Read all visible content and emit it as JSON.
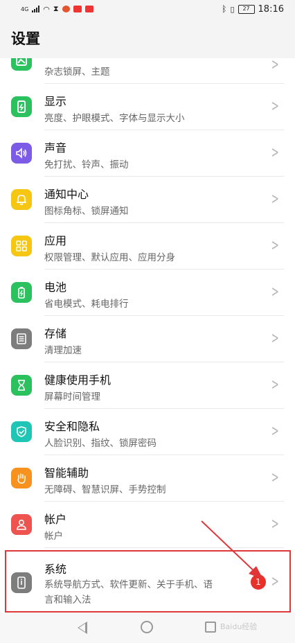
{
  "status_bar": {
    "network": "4G",
    "time": "18:16",
    "battery": "27"
  },
  "header": {
    "title": "设置"
  },
  "items": [
    {
      "title": "",
      "subtitle": "杂志锁屏、主题",
      "icon": "wallpaper-icon",
      "color": "#2cc15f"
    },
    {
      "title": "显示",
      "subtitle": "亮度、护眼模式、字体与显示大小",
      "icon": "display-icon",
      "color": "#2cc15f"
    },
    {
      "title": "声音",
      "subtitle": "免打扰、铃声、振动",
      "icon": "speaker-icon",
      "color": "#7c5be6"
    },
    {
      "title": "通知中心",
      "subtitle": "图标角标、锁屏通知",
      "icon": "bell-icon",
      "color": "#f6c612"
    },
    {
      "title": "应用",
      "subtitle": "权限管理、默认应用、应用分身",
      "icon": "apps-grid-icon",
      "color": "#f6c612"
    },
    {
      "title": "电池",
      "subtitle": "省电模式、耗电排行",
      "icon": "battery-icon",
      "color": "#2cc15f"
    },
    {
      "title": "存储",
      "subtitle": "清理加速",
      "icon": "storage-icon",
      "color": "#7d7d7d"
    },
    {
      "title": "健康使用手机",
      "subtitle": "屏幕时间管理",
      "icon": "hourglass-icon",
      "color": "#2cc15f"
    },
    {
      "title": "安全和隐私",
      "subtitle": "人脸识别、指纹、锁屏密码",
      "icon": "shield-icon",
      "color": "#1fc6b6"
    },
    {
      "title": "智能辅助",
      "subtitle": "无障碍、智慧识屏、手势控制",
      "icon": "hand-icon",
      "color": "#f7921e"
    },
    {
      "title": "帐户",
      "subtitle": "帐户",
      "icon": "user-icon",
      "color": "#ef5350"
    },
    {
      "title": "系统",
      "subtitle_line1": "系统导航方式、软件更新、关于手机、语",
      "subtitle_line2": "言和输入法",
      "icon": "phone-info-icon",
      "color": "#7d7d7d",
      "badge": "1"
    }
  ],
  "watermark": "Baidu经验"
}
